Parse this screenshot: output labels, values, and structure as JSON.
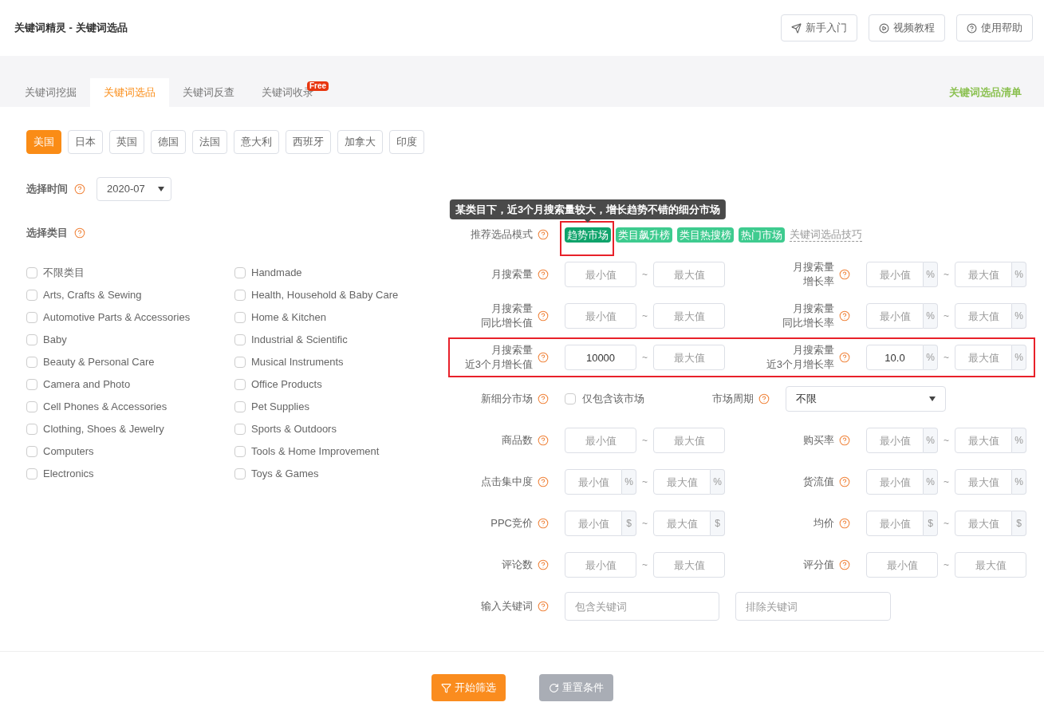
{
  "header": {
    "title": "关键词精灵 - 关键词选品",
    "buttons": [
      {
        "kind": "guide",
        "label": "新手入门"
      },
      {
        "kind": "video",
        "label": "视频教程"
      },
      {
        "kind": "help",
        "label": "使用帮助"
      }
    ]
  },
  "tabs": [
    {
      "label": "关键词挖掘",
      "selected": false
    },
    {
      "label": "关键词选品",
      "selected": true
    },
    {
      "label": "关键词反查",
      "selected": false
    },
    {
      "label": "关键词收录",
      "selected": false,
      "badge": "Free"
    }
  ],
  "tabs_link": "关键词选品清单",
  "countries": [
    {
      "label": "美国",
      "selected": true
    },
    {
      "label": "日本",
      "selected": false
    },
    {
      "label": "英国",
      "selected": false
    },
    {
      "label": "德国",
      "selected": false
    },
    {
      "label": "法国",
      "selected": false
    },
    {
      "label": "意大利",
      "selected": false
    },
    {
      "label": "西班牙",
      "selected": false
    },
    {
      "label": "加拿大",
      "selected": false
    },
    {
      "label": "印度",
      "selected": false
    }
  ],
  "time": {
    "label": "选择时间",
    "value": "2020-07"
  },
  "category": {
    "label": "选择类目",
    "items": [
      {
        "label": "不限类目",
        "checked": false
      },
      {
        "label": "Arts, Crafts & Sewing",
        "checked": false
      },
      {
        "label": "Automotive Parts & Accessories",
        "checked": false
      },
      {
        "label": "Baby",
        "checked": false
      },
      {
        "label": "Beauty & Personal Care",
        "checked": false
      },
      {
        "label": "Camera and Photo",
        "checked": false
      },
      {
        "label": "Cell Phones & Accessories",
        "checked": false
      },
      {
        "label": "Clothing, Shoes & Jewelry",
        "checked": false
      },
      {
        "label": "Computers",
        "checked": false
      },
      {
        "label": "Electronics",
        "checked": false
      },
      {
        "label": "Handmade",
        "checked": false
      },
      {
        "label": "Health, Household & Baby Care",
        "checked": false
      },
      {
        "label": "Home & Kitchen",
        "checked": false
      },
      {
        "label": "Industrial & Scientific",
        "checked": false
      },
      {
        "label": "Musical Instruments",
        "checked": false
      },
      {
        "label": "Office Products",
        "checked": false
      },
      {
        "label": "Pet Supplies",
        "checked": false
      },
      {
        "label": "Sports & Outdoors",
        "checked": false
      },
      {
        "label": "Tools & Home Improvement",
        "checked": false
      },
      {
        "label": "Toys & Games",
        "checked": false
      }
    ]
  },
  "mode": {
    "label": "推荐选品模式",
    "tags": [
      {
        "label": "趋势市场",
        "selected": true,
        "highlighted": true,
        "tooltip": "某类目下，近3个月搜索量较大，增长趋势不错的细分市场"
      },
      {
        "label": "类目飙升榜",
        "selected": false,
        "highlighted": false
      },
      {
        "label": "类目热搜榜",
        "selected": false,
        "highlighted": false
      },
      {
        "label": "热门市场",
        "selected": false,
        "highlighted": false
      }
    ],
    "link": "关键词选品技巧"
  },
  "filter_rows": [
    {
      "highlighted": false,
      "cells": [
        {
          "kind": "range",
          "label": [
            "月搜索量"
          ],
          "min": {
            "placeholder": "最小值"
          },
          "max": {
            "placeholder": "最大值"
          }
        },
        {
          "kind": "range",
          "label": [
            "月搜索量",
            "增长率"
          ],
          "unit": "%",
          "min": {
            "placeholder": "最小值"
          },
          "max": {
            "placeholder": "最大值"
          }
        }
      ]
    },
    {
      "highlighted": false,
      "cells": [
        {
          "kind": "range",
          "label": [
            "月搜索量",
            "同比增长值"
          ],
          "min": {
            "placeholder": "最小值"
          },
          "max": {
            "placeholder": "最大值"
          }
        },
        {
          "kind": "range",
          "label": [
            "月搜索量",
            "同比增长率"
          ],
          "unit": "%",
          "min": {
            "placeholder": "最小值"
          },
          "max": {
            "placeholder": "最大值"
          }
        }
      ]
    },
    {
      "highlighted": true,
      "cells": [
        {
          "kind": "range",
          "label": [
            "月搜索量",
            "近3个月增长值"
          ],
          "min": {
            "value": "10000"
          },
          "max": {
            "placeholder": "最大值"
          }
        },
        {
          "kind": "range",
          "label": [
            "月搜索量",
            "近3个月增长率"
          ],
          "unit": "%",
          "min": {
            "value": "10.0"
          },
          "max": {
            "placeholder": "最大值"
          }
        }
      ]
    },
    {
      "highlighted": false,
      "cells": [
        {
          "kind": "checkbox",
          "label": [
            "新细分市场"
          ],
          "option": "仅包含该市场",
          "checked": false
        },
        {
          "kind": "select",
          "label": [
            "市场周期"
          ],
          "value": "不限"
        }
      ]
    },
    {
      "highlighted": false,
      "cells": [
        {
          "kind": "range",
          "label": [
            "商品数"
          ],
          "min": {
            "placeholder": "最小值"
          },
          "max": {
            "placeholder": "最大值"
          }
        },
        {
          "kind": "range",
          "label": [
            "购买率"
          ],
          "unit": "%",
          "min": {
            "placeholder": "最小值"
          },
          "max": {
            "placeholder": "最大值"
          }
        }
      ]
    },
    {
      "highlighted": false,
      "cells": [
        {
          "kind": "range",
          "label": [
            "点击集中度"
          ],
          "unit": "%",
          "min": {
            "placeholder": "最小值"
          },
          "max": {
            "placeholder": "最大值"
          }
        },
        {
          "kind": "range",
          "label": [
            "货流值"
          ],
          "unit": "%",
          "min": {
            "placeholder": "最小值"
          },
          "max": {
            "placeholder": "最大值"
          }
        }
      ]
    },
    {
      "highlighted": false,
      "cells": [
        {
          "kind": "range",
          "label": [
            "PPC竞价"
          ],
          "unit": "$",
          "min": {
            "placeholder": "最小值"
          },
          "max": {
            "placeholder": "最大值"
          }
        },
        {
          "kind": "range",
          "label": [
            "均价"
          ],
          "unit": "$",
          "min": {
            "placeholder": "最小值"
          },
          "max": {
            "placeholder": "最大值"
          }
        }
      ]
    },
    {
      "highlighted": false,
      "cells": [
        {
          "kind": "range",
          "label": [
            "评论数"
          ],
          "min": {
            "placeholder": "最小值"
          },
          "max": {
            "placeholder": "最大值"
          }
        },
        {
          "kind": "range",
          "label": [
            "评分值"
          ],
          "min": {
            "placeholder": "最小值"
          },
          "max": {
            "placeholder": "最大值"
          }
        }
      ]
    },
    {
      "highlighted": false,
      "cells": [
        {
          "kind": "keywords",
          "label": [
            "输入关键词"
          ],
          "include": {
            "placeholder": "包含关键词"
          },
          "exclude": {
            "placeholder": "排除关键词"
          }
        }
      ]
    }
  ],
  "range_separator": "~",
  "actions": [
    {
      "kind": "filter",
      "label": "开始筛选",
      "disabled": false
    },
    {
      "kind": "reset",
      "label": "重置条件",
      "disabled": true
    }
  ]
}
